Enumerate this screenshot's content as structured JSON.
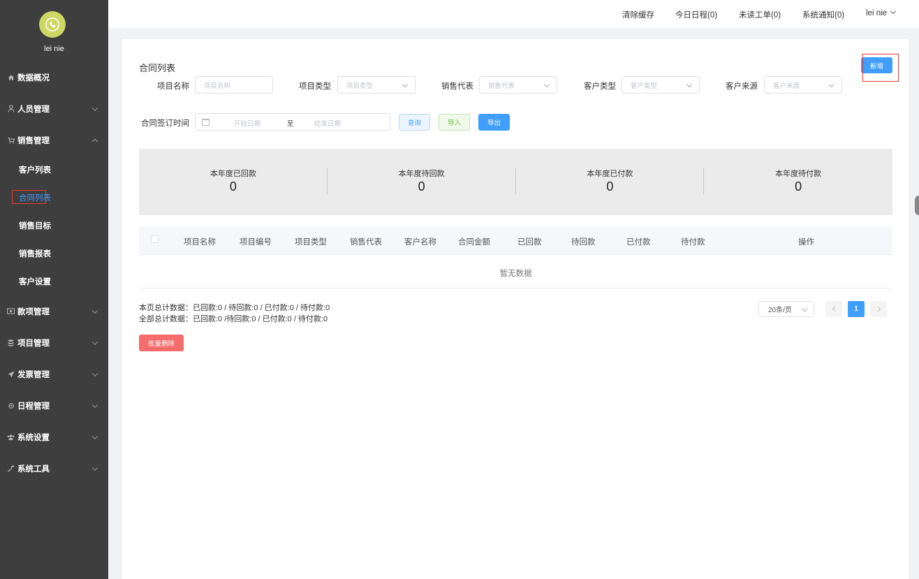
{
  "sidebar": {
    "username": "lei nie",
    "menu": [
      {
        "label": "数据概况",
        "icon": "home-icon"
      },
      {
        "label": "人员管理",
        "icon": "user-icon"
      },
      {
        "label": "销售管理",
        "icon": "cart-icon",
        "children": [
          "客户列表",
          "合同列表",
          "销售目标",
          "销售报表",
          "客户设置"
        ],
        "active_child": "合同列表"
      },
      {
        "label": "款项管理",
        "icon": "money-icon"
      },
      {
        "label": "项目管理",
        "icon": "database-icon"
      },
      {
        "label": "发票管理",
        "icon": "send-icon"
      },
      {
        "label": "日程管理",
        "icon": "gear-icon"
      },
      {
        "label": "系统设置",
        "icon": "users-icon"
      },
      {
        "label": "系统工具",
        "icon": "wrench-icon"
      }
    ]
  },
  "topbar": {
    "clear_cache": "清除缓存",
    "today_schedule": "今日日程(0)",
    "unread_orders": "未读工单(0)",
    "notifications": "系统通知(0)",
    "user": "lei nie"
  },
  "page": {
    "title": "合同列表",
    "add_button": "新增"
  },
  "filters": {
    "project_name": {
      "label": "项目名称",
      "placeholder": "项目名称"
    },
    "project_type": {
      "label": "项目类型",
      "placeholder": "项目类型"
    },
    "sales_rep": {
      "label": "销售代表",
      "placeholder": "销售代表"
    },
    "customer_type": {
      "label": "客户类型",
      "placeholder": "客户类型"
    },
    "customer_source": {
      "label": "客户来源",
      "placeholder": "客户来源"
    },
    "sign_time": {
      "label": "合同签订时间",
      "start_placeholder": "开始日期",
      "separator": "至",
      "end_placeholder": "结束日期"
    },
    "query_button": "查询",
    "import_button": "导入",
    "export_button": "导出"
  },
  "stats": [
    {
      "label": "本年度已回款",
      "value": "0"
    },
    {
      "label": "本年度待回款",
      "value": "0"
    },
    {
      "label": "本年度已付款",
      "value": "0"
    },
    {
      "label": "本年度待付款",
      "value": "0"
    }
  ],
  "table": {
    "columns": [
      "项目名称",
      "项目编号",
      "项目类型",
      "销售代表",
      "客户名称",
      "合同金额",
      "已回款",
      "待回款",
      "已付款",
      "待付款",
      "操作"
    ],
    "empty_text": "暂无数据"
  },
  "summary": {
    "page_total": "本页总计数据：已回款:0 / 待回款:0 / 已付款:0 / 待付款:0",
    "all_total": "全部总计数据：已回款:0 /待回款:0 / 已付款:0 / 待付款:0"
  },
  "pagination": {
    "page_size": "20条/页",
    "current_page": "1"
  },
  "batch_delete_button": "批量删除",
  "colors": {
    "sidebar_bg": "#3e3e3e",
    "primary": "#409eff",
    "success": "#67c23a",
    "danger": "#f56c6c",
    "avatar": "#cdd864"
  }
}
